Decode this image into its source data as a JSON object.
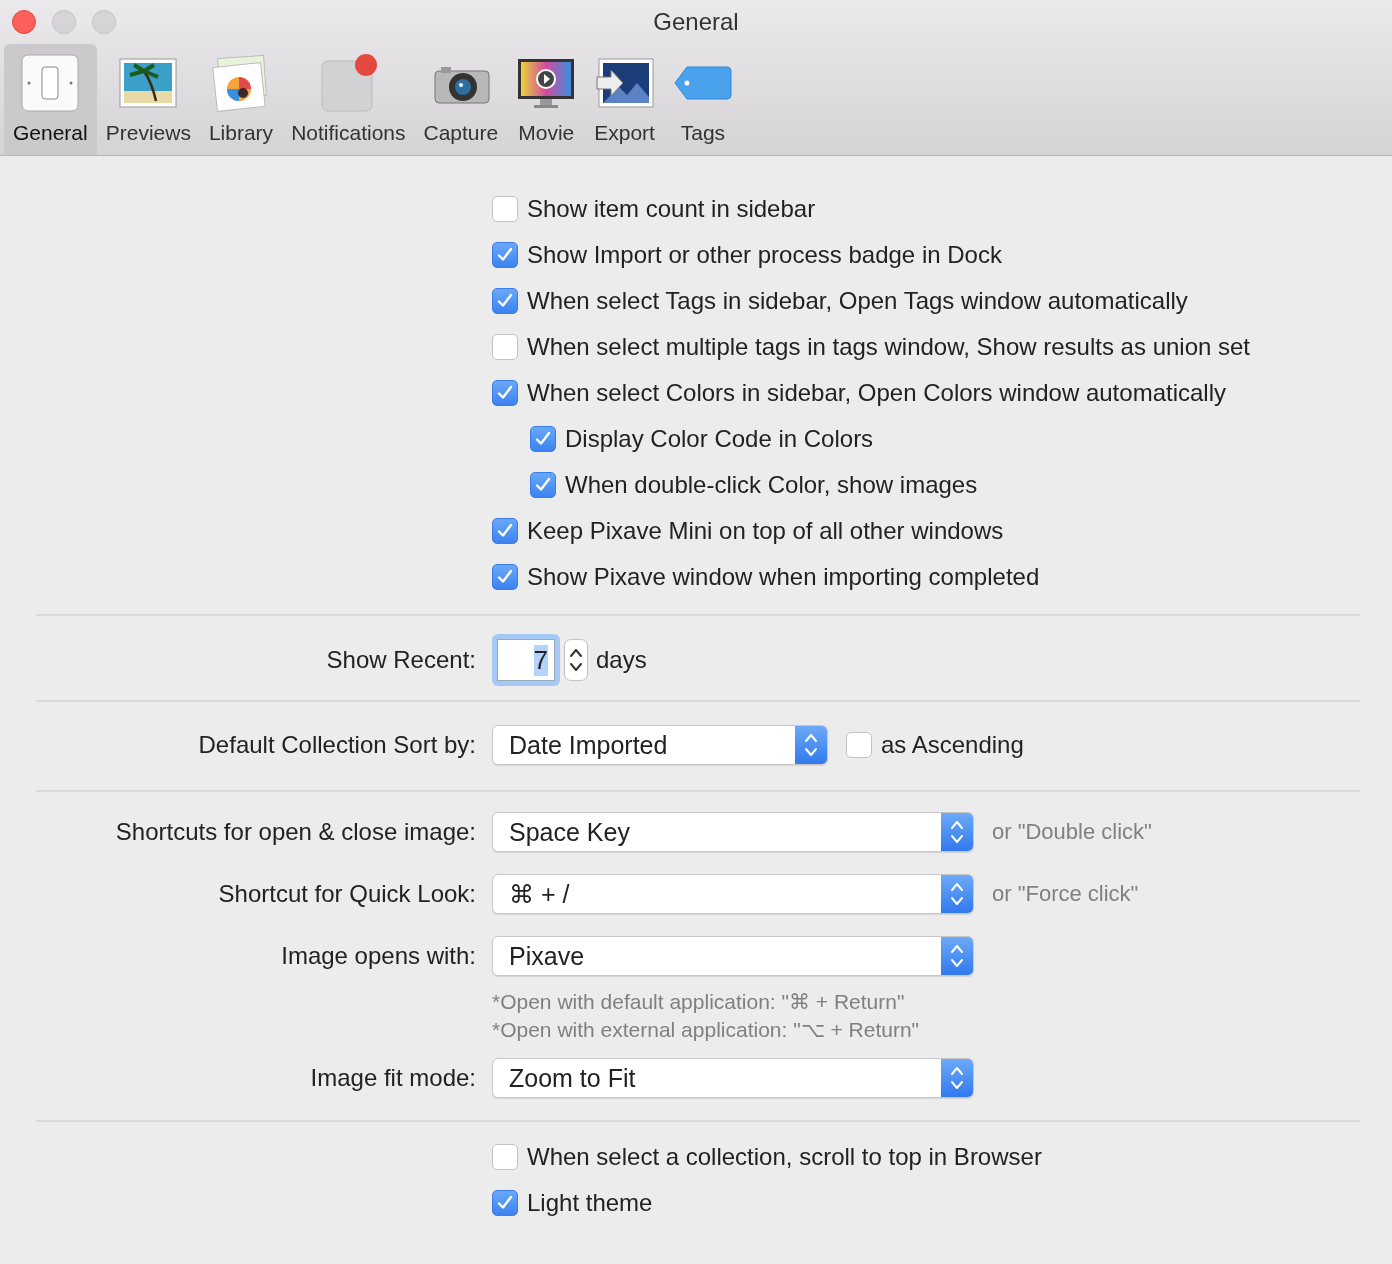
{
  "window": {
    "title": "General"
  },
  "toolbar": [
    {
      "kind": "switch",
      "label": "General",
      "selected": true
    },
    {
      "kind": "photo",
      "label": "Previews",
      "selected": false
    },
    {
      "kind": "library",
      "label": "Library",
      "selected": false
    },
    {
      "kind": "notification",
      "label": "Notifications",
      "selected": false
    },
    {
      "kind": "camera",
      "label": "Capture",
      "selected": false
    },
    {
      "kind": "monitor",
      "label": "Movie",
      "selected": false
    },
    {
      "kind": "export",
      "label": "Export",
      "selected": false
    },
    {
      "kind": "tag",
      "label": "Tags",
      "selected": false
    }
  ],
  "options": [
    {
      "label": "Show item count in sidebar",
      "checked": false
    },
    {
      "label": "Show Import or other process badge in Dock",
      "checked": true
    },
    {
      "label": "When select Tags in sidebar, Open Tags window automatically",
      "checked": true
    },
    {
      "label": "When select multiple tags in tags window, Show results as union set",
      "checked": false
    },
    {
      "label": "When select Colors in sidebar, Open Colors window automatically",
      "checked": true,
      "children": [
        {
          "label": "Display Color Code in Colors",
          "checked": true
        },
        {
          "label": "When double-click Color, show images",
          "checked": true
        }
      ]
    },
    {
      "label": "Keep Pixave Mini on top of all other windows",
      "checked": true
    },
    {
      "label": "Show Pixave window when importing completed",
      "checked": true
    }
  ],
  "show_recent": {
    "label": "Show Recent:",
    "value": "7",
    "unit": "days"
  },
  "sort": {
    "label": "Default Collection Sort by:",
    "value": "Date Imported",
    "ascending": {
      "label": "as Ascending",
      "checked": false
    }
  },
  "shortcuts": [
    {
      "label": "Shortcuts for open & close image:",
      "value": "Space Key",
      "hint": "or \"Double click\""
    },
    {
      "label": "Shortcut for Quick Look:",
      "value": "⌘ + /",
      "hint": "or \"Force click\""
    },
    {
      "label": "Image opens with:",
      "value": "Pixave",
      "notes": [
        "*Open with default application: \"⌘ + Return\"",
        "*Open with external application: \"⌥ + Return\""
      ]
    },
    {
      "label": "Image fit mode:",
      "value": "Zoom to Fit"
    }
  ],
  "bottom_options": [
    {
      "label": "When select a collection, scroll to top in Browser",
      "checked": false
    },
    {
      "label": "Light theme",
      "checked": true
    }
  ]
}
